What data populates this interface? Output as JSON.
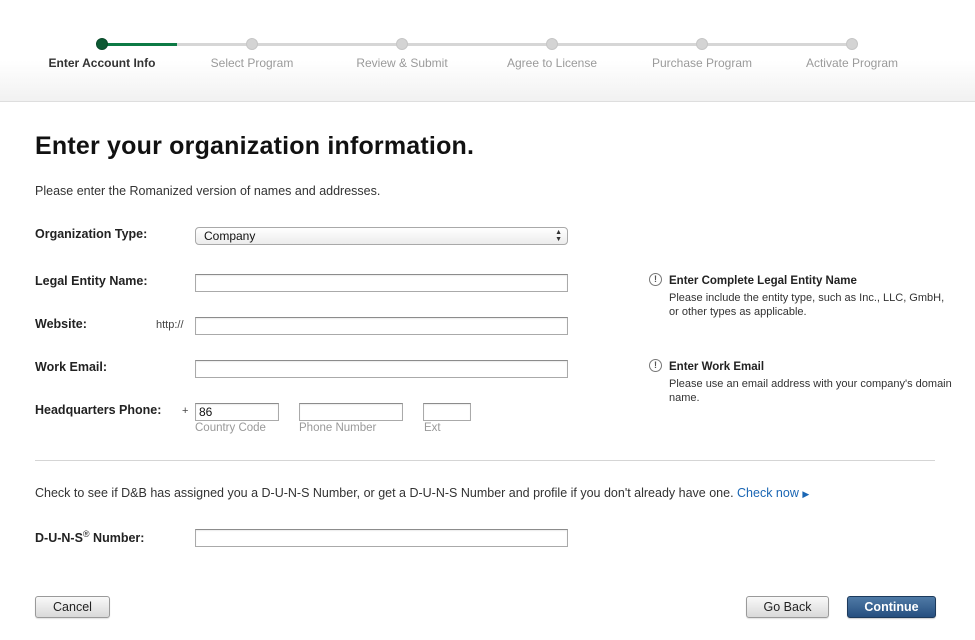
{
  "steps": [
    {
      "label": "Enter Account Info",
      "state": "active"
    },
    {
      "label": "Select Program",
      "state": "upcoming"
    },
    {
      "label": "Review & Submit",
      "state": "upcoming"
    },
    {
      "label": "Agree to License",
      "state": "upcoming"
    },
    {
      "label": "Purchase Program",
      "state": "upcoming"
    },
    {
      "label": "Activate Program",
      "state": "upcoming"
    }
  ],
  "page": {
    "title": "Enter your organization information.",
    "intro": "Please enter the Romanized version of names and addresses."
  },
  "form": {
    "org_type": {
      "label": "Organization Type:",
      "value": "Company",
      "arrows": "▲▼"
    },
    "legal_name": {
      "label": "Legal Entity Name:",
      "value": ""
    },
    "website": {
      "label": "Website:",
      "prefix": "http://",
      "value": ""
    },
    "work_email": {
      "label": "Work Email:",
      "value": ""
    },
    "phone": {
      "label": "Headquarters Phone:",
      "plus": "+",
      "country_code": {
        "value": "86",
        "caption": "Country Code"
      },
      "number": {
        "value": "",
        "caption": "Phone Number"
      },
      "ext": {
        "value": "",
        "caption": "Ext"
      }
    },
    "duns": {
      "label_main": "D-U-N-S",
      "label_reg": "®",
      "label_rest": " Number:",
      "value": ""
    }
  },
  "hints": {
    "legal": {
      "icon": "exclamation-icon",
      "title": "Enter Complete Legal Entity Name",
      "body": "Please include the entity type, such as Inc., LLC, GmbH, or other types as applicable."
    },
    "email": {
      "icon": "exclamation-icon",
      "title": "Enter Work Email",
      "body": "Please use an email address with your company's domain name."
    }
  },
  "duns_prompt": {
    "text": "Check to see if D&B has assigned you a D-U-N-S Number, or get a D-U-N-S Number and profile if you don't already have one.",
    "link": "Check now",
    "arrow": "▶"
  },
  "buttons": {
    "cancel": "Cancel",
    "back": "Go Back",
    "continue": "Continue"
  },
  "colors": {
    "progress_active": "#0d7a45",
    "primary_button": "#264f7f",
    "link": "#1a66b4"
  }
}
